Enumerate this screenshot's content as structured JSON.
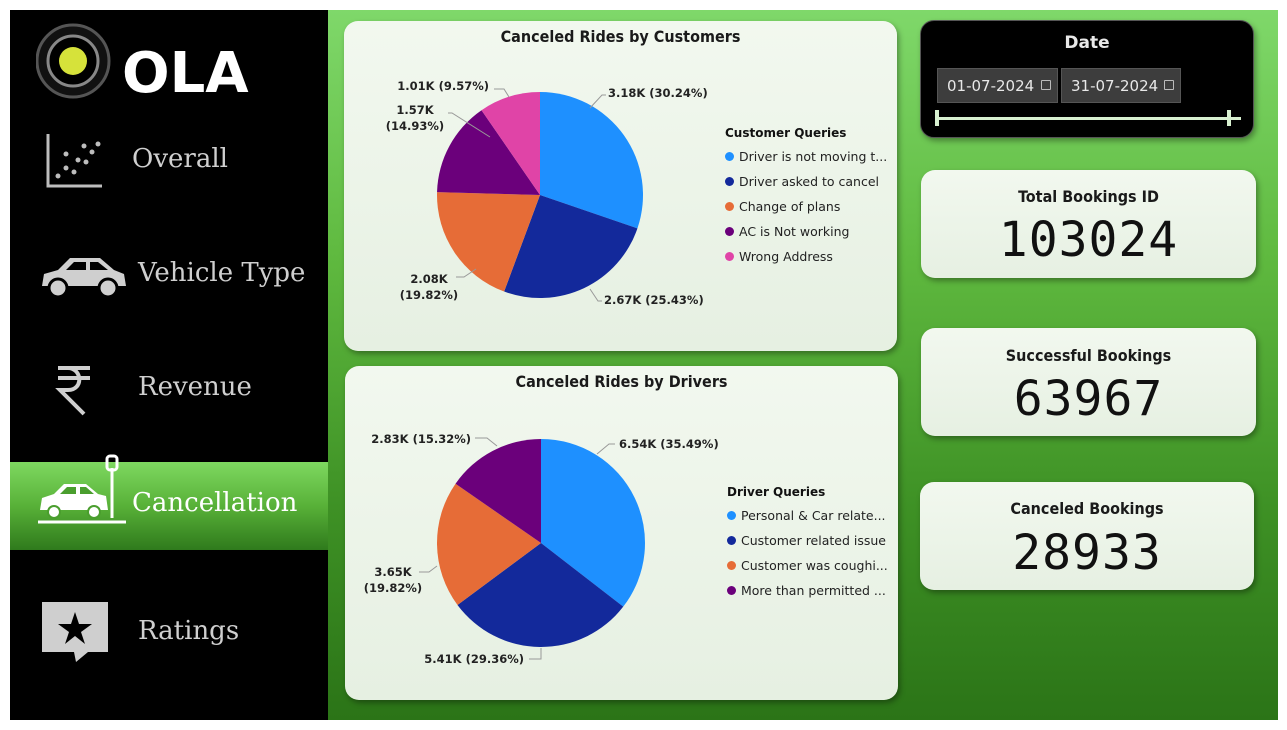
{
  "brand": {
    "name": "OLA"
  },
  "nav": [
    {
      "label": "Overall",
      "icon": "scatter-chart-icon",
      "active": false
    },
    {
      "label": "Vehicle Type",
      "icon": "car-icon",
      "active": false
    },
    {
      "label": "Revenue",
      "icon": "rupee-icon",
      "active": false
    },
    {
      "label": "Cancellation",
      "icon": "car-crash-icon",
      "active": true
    },
    {
      "label": "Ratings",
      "icon": "star-chat-icon",
      "active": false
    }
  ],
  "customer_chart": {
    "title": "Canceled Rides by Customers",
    "legend_title": "Customer Queries",
    "legend": [
      "Driver is not moving t...",
      "Driver asked to cancel",
      "Change of plans",
      "AC is Not working",
      "Wrong Address"
    ],
    "labels": [
      "3.18K (30.24%)",
      "2.67K (25.43%)",
      "2.08K",
      "(19.82%)",
      "1.57K",
      "(14.93%)",
      "1.01K (9.57%)"
    ]
  },
  "driver_chart": {
    "title": "Canceled Rides by Drivers",
    "legend_title": "Driver Queries",
    "legend": [
      "Personal & Car relate...",
      "Customer related issue",
      "Customer was coughi...",
      "More than permitted ..."
    ],
    "labels": [
      "6.54K (35.49%)",
      "5.41K (29.36%)",
      "3.65K",
      "(19.82%)",
      "2.83K (15.32%)"
    ]
  },
  "chart_data": [
    {
      "type": "pie",
      "title": "Canceled Rides by Customers",
      "legend_title": "Customer Queries",
      "categories": [
        "Driver is not moving t...",
        "Driver asked to cancel",
        "Change of plans",
        "AC is Not working",
        "Wrong Address"
      ],
      "values": [
        3180,
        2670,
        2080,
        1570,
        1010
      ],
      "percentages": [
        30.24,
        25.43,
        19.82,
        14.93,
        9.57
      ],
      "colors": [
        "#1e90ff",
        "#13299b",
        "#e66c37",
        "#6b007b",
        "#e044a7"
      ],
      "legend_position": "right"
    },
    {
      "type": "pie",
      "title": "Canceled Rides by Drivers",
      "legend_title": "Driver Queries",
      "categories": [
        "Personal & Car relate...",
        "Customer related issue",
        "Customer was coughi...",
        "More than permitted ..."
      ],
      "values": [
        6540,
        5410,
        3650,
        2830
      ],
      "percentages": [
        35.49,
        29.36,
        19.82,
        15.32
      ],
      "colors": [
        "#1e90ff",
        "#13299b",
        "#e66c37",
        "#6b007b"
      ],
      "legend_position": "right"
    }
  ],
  "date_filter": {
    "title": "Date",
    "start": "01-07-2024",
    "end": "31-07-2024"
  },
  "kpis": [
    {
      "label": "Total Bookings ID",
      "value": "103024"
    },
    {
      "label": "Successful Bookings",
      "value": "63967"
    },
    {
      "label": "Canceled Bookings",
      "value": "28933"
    }
  ]
}
